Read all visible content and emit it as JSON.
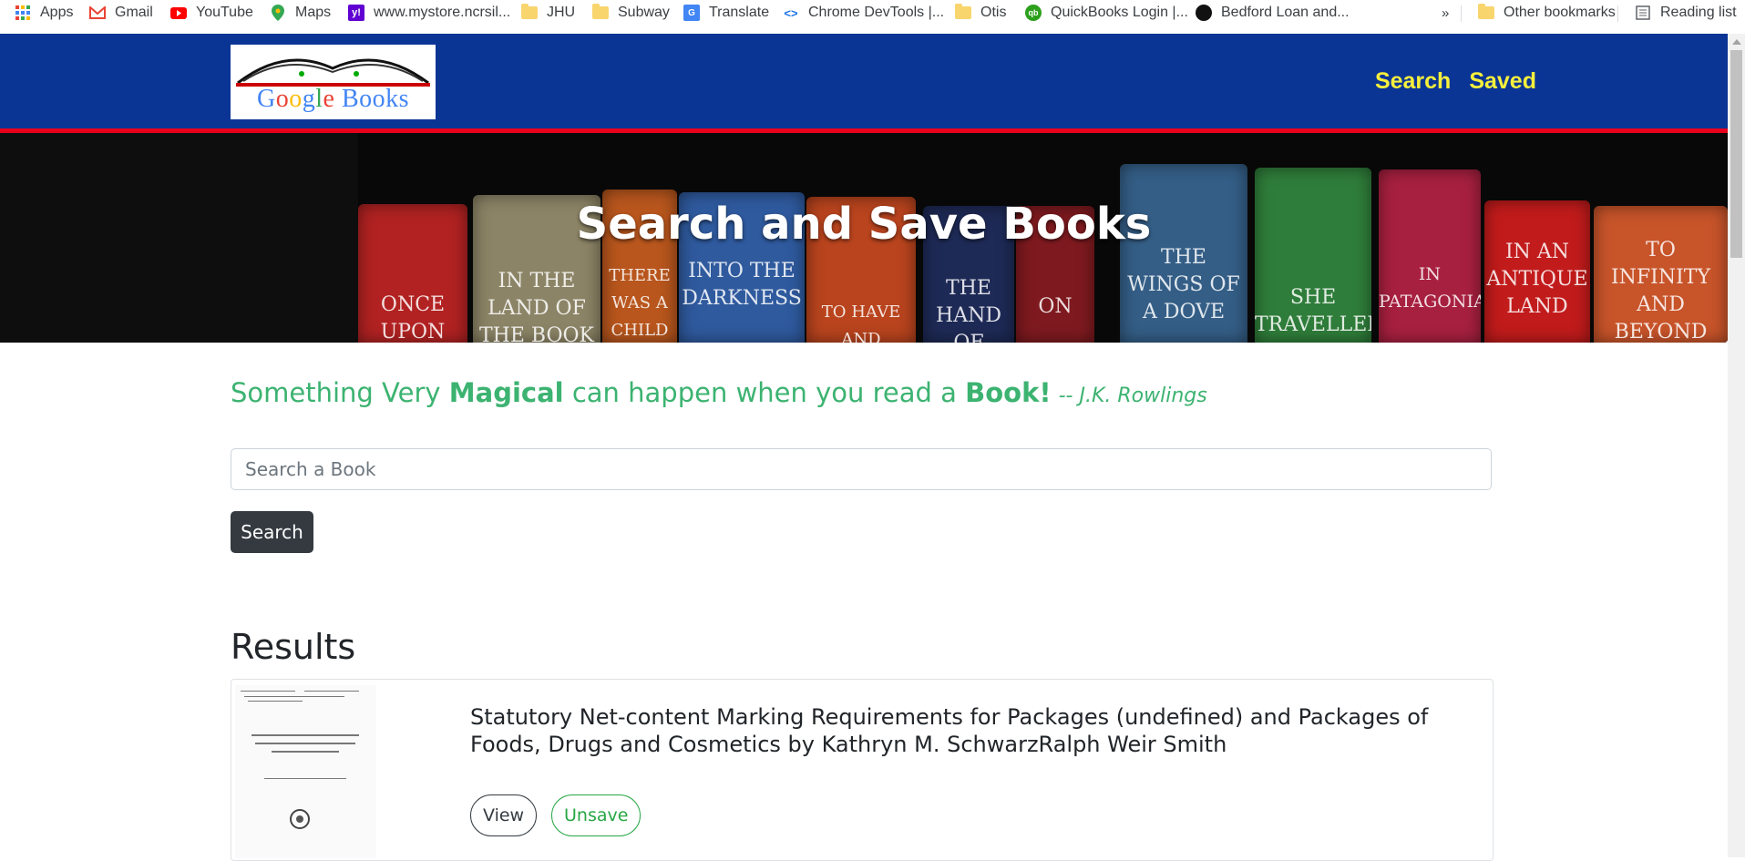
{
  "bookmarks": {
    "items": [
      {
        "label": "Apps",
        "icon": "apps-grid-icon"
      },
      {
        "label": "Gmail",
        "icon": "gmail-icon"
      },
      {
        "label": "YouTube",
        "icon": "youtube-icon"
      },
      {
        "label": "Maps",
        "icon": "maps-pin-icon"
      },
      {
        "label": "www.mystore.ncrsil...",
        "icon": "yahoo-icon"
      },
      {
        "label": "JHU",
        "icon": "folder-icon"
      },
      {
        "label": "Subway",
        "icon": "folder-icon"
      },
      {
        "label": "Translate",
        "icon": "translate-icon"
      },
      {
        "label": "Chrome DevTools |...",
        "icon": "devtools-icon"
      },
      {
        "label": "Otis",
        "icon": "folder-icon"
      },
      {
        "label": "QuickBooks Login |...",
        "icon": "quickbooks-icon"
      },
      {
        "label": "Bedford Loan and...",
        "icon": "bedford-icon"
      }
    ],
    "more": "»",
    "other": "Other bookmarks",
    "reading_list": "Reading list"
  },
  "navbar": {
    "logo_text": "Google Books",
    "links": [
      "Search",
      "Saved"
    ],
    "colors": {
      "background": "#0b3595",
      "link": "#f7ef3c",
      "border": "#e8001c"
    }
  },
  "hero": {
    "title": "Search and Save Books",
    "books": [
      "ONCE UPON",
      "IN THE LAND OF THE BOOK",
      "THERE WAS A CHILD",
      "INTO THE DARKNESS",
      "TO HAVE AND",
      "THE HAND OF",
      "ON",
      "THE WINGS OF A DOVE",
      "SHE TRAVELLED",
      "IN PATAGONIA",
      "IN AN ANTIQUE LAND",
      "TO INFINITY AND BEYOND"
    ]
  },
  "quote": {
    "part1": "Something Very ",
    "bold1": "Magical",
    "part2": " can happen when you read a ",
    "bold2": "Book!",
    "author": "-- J.K. Rowlings",
    "color": "#3cb371"
  },
  "search": {
    "placeholder": "Search a Book",
    "value": "",
    "button_label": "Search"
  },
  "results": {
    "heading": "Results",
    "items": [
      {
        "title": "Statutory Net-content Marking Requirements for Packages (undefined) and Packages of Foods, Drugs and Cosmetics by Kathryn M. SchwarzRalph Weir Smith",
        "view_label": "View",
        "unsave_label": "Unsave"
      }
    ]
  }
}
